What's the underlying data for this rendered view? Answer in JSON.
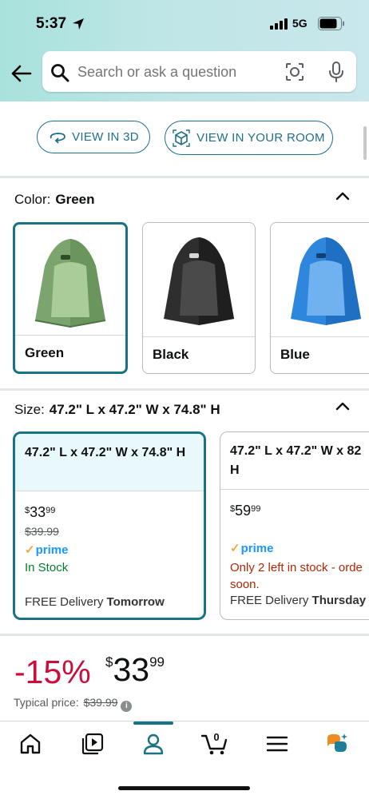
{
  "status_bar": {
    "time": "5:37",
    "network": "5G"
  },
  "search": {
    "placeholder": "Search or ask a question"
  },
  "view_buttons": {
    "view_3d": "VIEW IN 3D",
    "view_room": "VIEW IN YOUR ROOM"
  },
  "color": {
    "label": "Color:",
    "selected": "Green",
    "options": [
      {
        "name": "Green",
        "color": "#79a36c"
      },
      {
        "name": "Black",
        "color": "#2b2b2b"
      },
      {
        "name": "Blue",
        "color": "#2a7fd7"
      }
    ]
  },
  "size": {
    "label": "Size:",
    "selected": "47.2\" L x 47.2\" W x 74.8\" H",
    "options": [
      {
        "name": "47.2\" L x 47.2\" W x 74.8\" H",
        "price_whole": "33",
        "price_cents": "99",
        "currency": "$",
        "list_price": "$39.99",
        "prime": "prime",
        "stock": "In Stock",
        "delivery_prefix": "FREE Delivery",
        "delivery_day": "Tomorrow"
      },
      {
        "name": "47.2\" L x 47.2\" W x 82",
        "price_whole": "59",
        "price_cents": "99",
        "currency": "$",
        "prime": "prime",
        "stock": "Only 2 left in stock - orde soon.",
        "delivery_prefix": "FREE Delivery",
        "delivery_day": "Thursday"
      }
    ]
  },
  "price_summary": {
    "discount": "-15%",
    "currency": "$",
    "whole": "33",
    "cents": "99",
    "typical_label": "Typical price:",
    "typical_value": "$39.99"
  },
  "nav": {
    "cart_count": "0"
  },
  "colors": {
    "teal": "#187485",
    "deal_red": "#cc0c39",
    "prime_blue": "#1a98ff",
    "stock_green": "#067d2e"
  }
}
